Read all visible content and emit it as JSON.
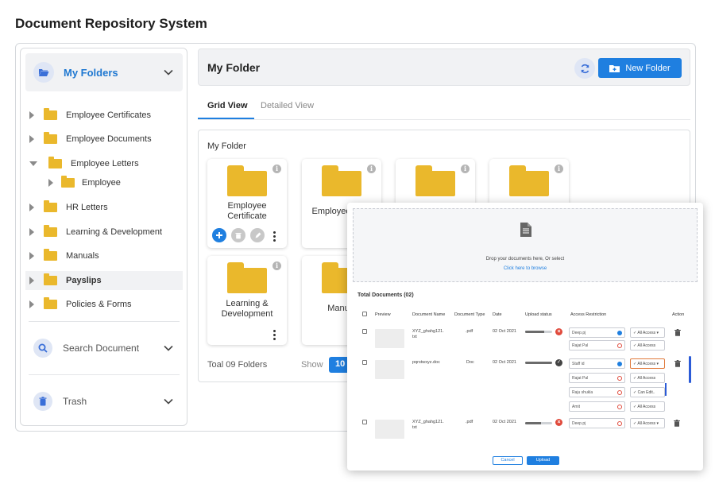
{
  "app": {
    "title": "Document Repository System"
  },
  "sidebar": {
    "my_folders": "My Folders",
    "tree": [
      {
        "label": "Employee Certificates",
        "expanded": false,
        "level": 0
      },
      {
        "label": "Employee Documents",
        "expanded": false,
        "level": 0
      },
      {
        "label": "Employee Letters",
        "expanded": true,
        "level": 0
      },
      {
        "label": "Employee",
        "expanded": false,
        "level": 1
      },
      {
        "label": "HR Letters",
        "expanded": false,
        "level": 0
      },
      {
        "label": "Learning & Development",
        "expanded": false,
        "level": 0
      },
      {
        "label": "Manuals",
        "expanded": false,
        "level": 0
      },
      {
        "label": "Payslips",
        "expanded": false,
        "level": 0,
        "selected": true
      },
      {
        "label": "Policies & Forms",
        "expanded": false,
        "level": 0
      }
    ],
    "search": "Search Document",
    "trash": "Trash"
  },
  "main": {
    "header_title": "My Folder",
    "new_folder": "New Folder",
    "tabs": [
      "Grid View",
      "Detailed View"
    ],
    "active_tab": "Grid View",
    "panel_title": "My Folder",
    "folders": [
      {
        "name": "Employee\nCertificate"
      },
      {
        "name": "Employee"
      },
      {
        "name": ""
      },
      {
        "name": ""
      },
      {
        "name": "Learning &\nDevelopment"
      },
      {
        "name": "Manu"
      }
    ],
    "total": "Toal 09 Folders",
    "show_label": "Show",
    "show_value": "10"
  },
  "upload": {
    "drop_text": "Drop your documents here, Or select",
    "browse_link": "Click here to browse",
    "total_docs": "Total Documents (02)",
    "columns": [
      "Preview",
      "Document Name",
      "Document Type",
      "Date",
      "Upload status",
      "Access Restriction",
      "Action"
    ],
    "rows": [
      {
        "name": "XYZ_ghahg121.\ntxt",
        "type": ".pdf",
        "date": "02 Oct 2021",
        "progress": 0.7,
        "status": "error",
        "restrictions": [
          {
            "user": "Deep.pj",
            "access": "All Access",
            "dot": "blue"
          },
          {
            "user": "Rajat Pal",
            "access": "All Access",
            "dot": "red"
          }
        ]
      },
      {
        "name": "pqrstwxyz.doc",
        "type": "Doc",
        "date": "02 Oct 2021",
        "progress": 1.0,
        "status": "done",
        "restrictions": [
          {
            "user": "Staff id",
            "access": "All Access",
            "dot": "blue",
            "active": true
          },
          {
            "user": "Rajat Pal",
            "access": "All Access",
            "dot": "red"
          },
          {
            "user": "Raju shukla",
            "access": "Can Edit..",
            "dot": "red"
          },
          {
            "user": "Amit",
            "access": "All Access",
            "dot": "red"
          }
        ]
      },
      {
        "name": "XYZ_ghahg121.\ntxt",
        "type": ".pdf",
        "date": "02 Oct 2021",
        "progress": 0.6,
        "status": "error",
        "restrictions": [
          {
            "user": "Deep.pj",
            "access": "All Access",
            "dot": "red"
          }
        ]
      }
    ],
    "cancel": "Cancel",
    "submit": "Upload"
  }
}
